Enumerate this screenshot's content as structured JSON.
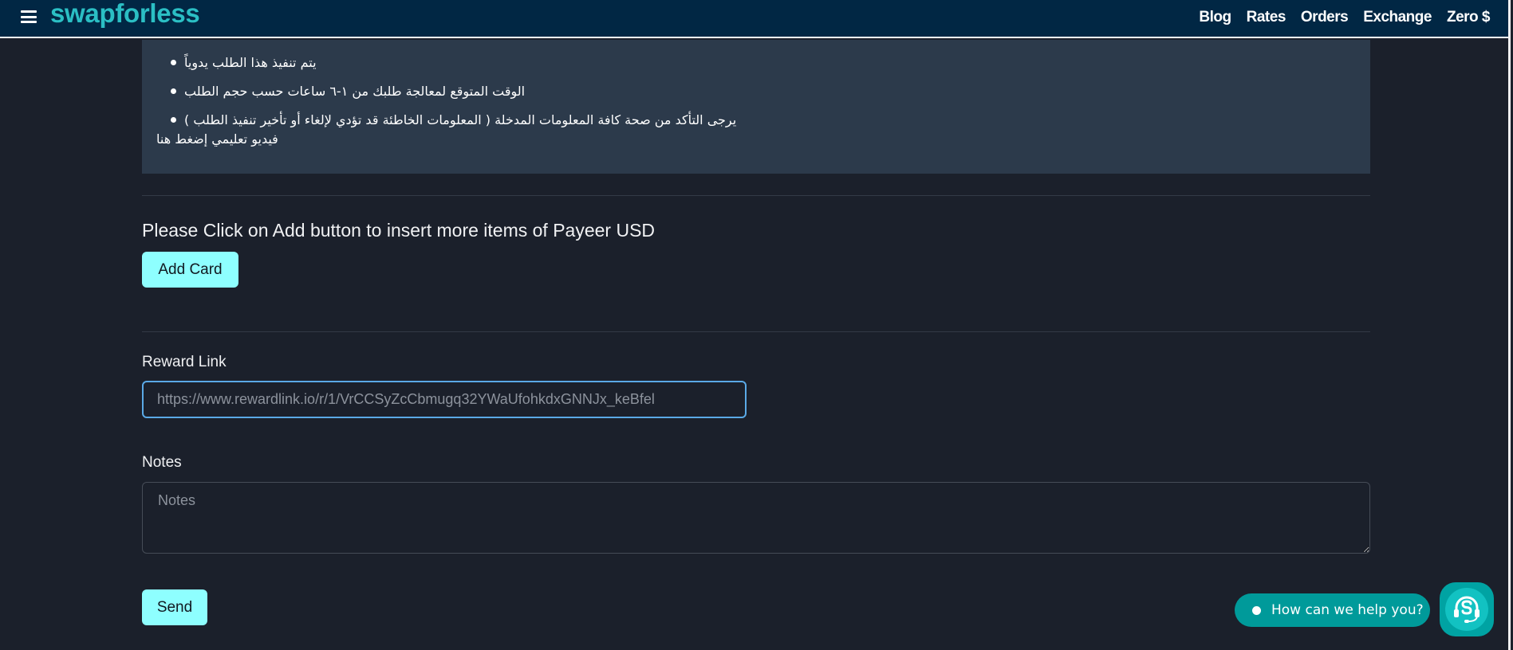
{
  "header": {
    "menu_icon": "hamburger-icon",
    "logo": "swapforless",
    "nav": [
      {
        "label": "Blog"
      },
      {
        "label": "Rates"
      },
      {
        "label": "Orders"
      },
      {
        "label": "Exchange"
      },
      {
        "label": "Zero $"
      }
    ]
  },
  "info": {
    "items": [
      "يتم تنفيذ هذا الطلب يدوياً",
      "الوقت المتوقع لمعالجة طلبك من ١-٦ ساعات حسب حجم الطلب",
      "يرجى التأكد من صحة كافة المعلومات المدخلة ( المعلومات الخاطئة قد تؤدي لإلغاء أو تأخير تنفيذ الطلب )"
    ],
    "video_link": "فيديو تعليمي إضغط هنا"
  },
  "form": {
    "add_instruction": "Please Click on Add button to insert more items of Payeer USD",
    "add_card_label": "Add Card",
    "reward_link_label": "Reward Link",
    "reward_link_placeholder": "https://www.rewardlink.io/r/1/VrCCSyZcCbmugq32YWaUfohkdxGNNJx_keBfel",
    "notes_label": "Notes",
    "notes_placeholder": "Notes",
    "send_label": "Send"
  },
  "chat": {
    "prompt": "How can we help you?",
    "launcher_icon": "support-headset-icon"
  },
  "colors": {
    "header_bg": "#012744",
    "logo": "#2bbfc4",
    "page_bg": "#1b202b",
    "info_bg": "#2c3a4b",
    "button_bg": "#8effff",
    "input_focus_border": "#5aa9e6",
    "chat_bg": "#009a9a"
  }
}
